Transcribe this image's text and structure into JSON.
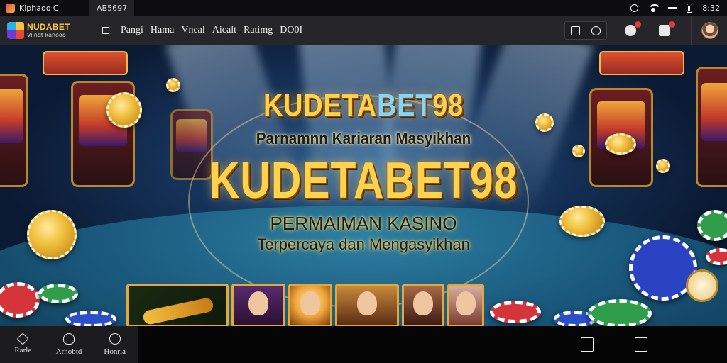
{
  "status_bar": {
    "app_label": "Kiphaoo C",
    "tab_label": "AB5697",
    "time": "8:32"
  },
  "header": {
    "brand_name": "NUDABET",
    "brand_sub": "Vilndt kanooo",
    "nav": [
      "Pangi",
      "Hama",
      "Vneal",
      "Aicalt",
      "Ratimg",
      "DO0I"
    ]
  },
  "hero": {
    "title_top_gold": "KUDETA",
    "title_top_blue": "BET",
    "title_top_gold_end": "98",
    "subtitle_1": "Parnamnn Kariaran Masyikhan",
    "title_main": "KUDETABET98",
    "subtitle_2": "PERMAIMAN KASINO",
    "subtitle_3": "Terpercaya dan Mengasyikhan"
  },
  "bottom_nav": [
    {
      "label": "Rarle",
      "icon": "home-icon"
    },
    {
      "label": "Arhobtd",
      "icon": "bulb-icon"
    },
    {
      "label": "Honria",
      "icon": "info-icon"
    }
  ],
  "colors": {
    "accent_gold": "#ffd24d",
    "accent_blue": "#7fd6ff",
    "header_bg": "#26262a",
    "badge_red": "#e23a3a"
  }
}
